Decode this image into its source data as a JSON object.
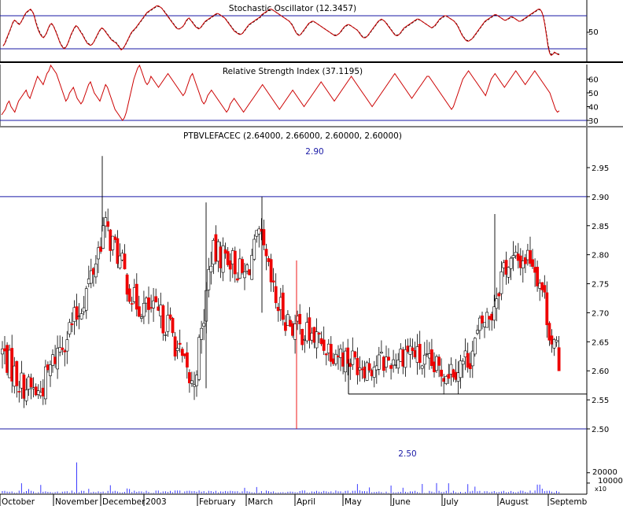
{
  "chart_data": {
    "type": "candlestick",
    "ticker_title": "PTBVLEFACEC (2.64000, 2.66000, 2.60000, 2.60000)",
    "last_bar": {
      "open": 2.64,
      "high": 2.66,
      "low": 2.6,
      "close": 2.6
    },
    "price_axis": {
      "ticks": [
        "2.95",
        "2.90",
        "2.85",
        "2.80",
        "2.75",
        "2.70",
        "2.65",
        "2.60",
        "2.55",
        "2.50"
      ],
      "range": [
        2.48,
        2.99
      ]
    },
    "stochastic": {
      "title": "Stochastic Oscillator (12.3457)",
      "tick": "50",
      "upper_level": 80,
      "lower_level": 20,
      "k": [
        25,
        30,
        38,
        45,
        52,
        60,
        68,
        72,
        70,
        66,
        64,
        68,
        74,
        80,
        85,
        88,
        90,
        92,
        88,
        82,
        70,
        60,
        52,
        46,
        42,
        40,
        44,
        50,
        58,
        64,
        66,
        62,
        55,
        48,
        40,
        32,
        26,
        22,
        20,
        24,
        30,
        38,
        46,
        52,
        58,
        62,
        60,
        55,
        50,
        46,
        40,
        35,
        30,
        28,
        26,
        28,
        32,
        38,
        44,
        50,
        55,
        58,
        56,
        52,
        48,
        44,
        40,
        36,
        34,
        32,
        30,
        26,
        22,
        18,
        20,
        24,
        30,
        36,
        42,
        48,
        52,
        55,
        58,
        62,
        66,
        70,
        74,
        78,
        82,
        86,
        88,
        90,
        92,
        94,
        96,
        98,
        98,
        96,
        94,
        90,
        86,
        82,
        78,
        74,
        70,
        66,
        62,
        58,
        56,
        56,
        58,
        60,
        64,
        70,
        74,
        76,
        72,
        68,
        64,
        60,
        58,
        56,
        58,
        62,
        66,
        70,
        72,
        74,
        76,
        78,
        80,
        82,
        84,
        84,
        82,
        80,
        78,
        76,
        72,
        68,
        64,
        60,
        56,
        52,
        50,
        48,
        46,
        46,
        48,
        52,
        56,
        60,
        64,
        66,
        68,
        70,
        72,
        74,
        76,
        78,
        82,
        84,
        86,
        88,
        90,
        92,
        92,
        90,
        88,
        86,
        84,
        82,
        80,
        78,
        76,
        74,
        72,
        70,
        66,
        62,
        56,
        50,
        46,
        44,
        46,
        50,
        54,
        58,
        62,
        66,
        68,
        70,
        70,
        68,
        66,
        64,
        62,
        60,
        58,
        56,
        54,
        52,
        50,
        48,
        46,
        44,
        44,
        46,
        48,
        52,
        56,
        60,
        62,
        64,
        64,
        62,
        60,
        58,
        56,
        54,
        50,
        46,
        42,
        40,
        40,
        42,
        46,
        50,
        54,
        58,
        62,
        66,
        70,
        72,
        74,
        72,
        70,
        66,
        62,
        58,
        54,
        50,
        46,
        44,
        44,
        46,
        50,
        54,
        58,
        60,
        62,
        64,
        66,
        68,
        70,
        72,
        74,
        74,
        72,
        70,
        68,
        66,
        64,
        62,
        60,
        58,
        60,
        62,
        66,
        70,
        74,
        76,
        78,
        80,
        80,
        78,
        76,
        74,
        72,
        70,
        66,
        62,
        56,
        50,
        44,
        40,
        36,
        34,
        34,
        36,
        38,
        42,
        46,
        50,
        54,
        58,
        62,
        66,
        70,
        72,
        74,
        76,
        78,
        80,
        82,
        82,
        80,
        78,
        76,
        74,
        72,
        72,
        74,
        76,
        78,
        78,
        76,
        74,
        72,
        70,
        70,
        72,
        74,
        76,
        78,
        80,
        82,
        84,
        86,
        88,
        90,
        92,
        92,
        88,
        80,
        65,
        45,
        25,
        12,
        8,
        10,
        14,
        12,
        10,
        9
      ],
      "d": [
        26,
        29,
        36,
        44,
        51,
        59,
        67,
        71,
        70,
        67,
        65,
        68,
        73,
        79,
        84,
        87,
        89,
        91,
        88,
        83,
        72,
        62,
        54,
        48,
        43,
        41,
        44,
        49,
        57,
        63,
        65,
        62,
        56,
        49,
        41,
        33,
        27,
        23,
        21,
        24,
        29,
        37,
        45,
        51,
        57,
        61,
        60,
        56,
        51,
        47,
        41,
        36,
        31,
        29,
        27,
        28,
        32,
        37,
        43,
        49,
        54,
        57,
        56,
        53,
        49,
        45,
        41,
        37,
        35,
        33,
        31,
        27,
        23,
        19,
        20,
        24,
        29,
        35,
        41,
        47,
        51,
        54,
        57,
        61,
        65,
        69,
        73,
        77,
        81,
        85,
        87,
        89,
        91,
        93,
        95,
        97,
        97,
        96,
        94,
        91,
        87,
        83,
        79,
        75,
        71,
        67,
        63,
        59,
        57,
        56,
        58,
        60,
        63,
        69,
        73,
        75,
        72,
        69,
        65,
        61,
        59,
        57,
        58,
        61,
        65,
        69,
        71,
        73,
        75,
        77,
        79,
        81,
        83,
        83,
        82,
        80,
        78,
        76,
        73,
        69,
        65,
        61,
        57,
        53,
        51,
        49,
        47,
        47,
        48,
        51,
        55,
        59,
        63,
        65,
        67,
        69,
        71,
        73,
        75,
        77,
        81,
        83,
        85,
        87,
        89,
        91,
        91,
        90,
        88,
        86,
        84,
        82,
        80,
        78,
        76,
        74,
        72,
        70,
        67,
        63,
        57,
        51,
        47,
        45,
        46,
        49,
        53,
        57,
        61,
        65,
        67,
        69,
        69,
        68,
        66,
        64,
        62,
        60,
        58,
        56,
        54,
        52,
        50,
        48,
        46,
        45,
        45,
        46,
        48,
        51,
        55,
        59,
        61,
        63,
        63,
        62,
        60,
        58,
        56,
        54,
        51,
        47,
        43,
        41,
        41,
        42,
        45,
        49,
        53,
        57,
        61,
        65,
        69,
        71,
        73,
        72,
        70,
        67,
        63,
        59,
        55,
        51,
        47,
        45,
        45,
        46,
        49,
        53,
        57,
        59,
        61,
        63,
        65,
        67,
        69,
        71,
        73,
        73,
        72,
        70,
        68,
        66,
        64,
        62,
        60,
        58,
        59,
        61,
        65,
        69,
        73,
        75,
        77,
        79,
        79,
        78,
        76,
        74,
        72,
        70,
        67,
        63,
        57,
        51,
        45,
        41,
        37,
        35,
        35,
        36,
        38,
        41,
        45,
        49,
        53,
        57,
        61,
        65,
        69,
        71,
        73,
        75,
        77,
        79,
        81,
        81,
        80,
        78,
        76,
        74,
        72,
        72,
        73,
        75,
        77,
        77,
        76,
        74,
        72,
        70,
        70,
        71,
        73,
        75,
        77,
        79,
        81,
        83,
        85,
        87,
        89,
        91,
        91,
        88,
        81,
        67,
        48,
        29,
        15,
        10,
        10,
        13,
        12,
        11,
        10
      ]
    },
    "rsi": {
      "title": "Relative Strength Index (37.1195)",
      "ticks": [
        "60",
        "50",
        "40",
        "30"
      ],
      "upper_level": 70,
      "lower_level": 30,
      "values": [
        34,
        36,
        38,
        42,
        44,
        40,
        38,
        36,
        40,
        44,
        46,
        48,
        50,
        52,
        48,
        46,
        50,
        54,
        58,
        62,
        60,
        58,
        56,
        60,
        64,
        66,
        70,
        68,
        66,
        64,
        60,
        56,
        52,
        48,
        44,
        46,
        50,
        52,
        54,
        50,
        46,
        44,
        42,
        44,
        48,
        52,
        56,
        58,
        54,
        50,
        48,
        46,
        44,
        48,
        52,
        56,
        54,
        50,
        46,
        42,
        38,
        36,
        34,
        32,
        30,
        32,
        36,
        42,
        48,
        54,
        60,
        64,
        68,
        70,
        66,
        62,
        58,
        56,
        58,
        62,
        60,
        58,
        56,
        54,
        56,
        58,
        60,
        62,
        64,
        62,
        60,
        58,
        56,
        54,
        52,
        50,
        48,
        50,
        54,
        58,
        62,
        64,
        60,
        56,
        52,
        48,
        44,
        42,
        44,
        48,
        50,
        52,
        50,
        48,
        46,
        44,
        42,
        40,
        38,
        36,
        38,
        42,
        44,
        46,
        44,
        42,
        40,
        38,
        36,
        38,
        40,
        42,
        44,
        46,
        48,
        50,
        52,
        54,
        56,
        54,
        52,
        50,
        48,
        46,
        44,
        42,
        40,
        38,
        40,
        42,
        44,
        46,
        48,
        50,
        52,
        50,
        48,
        46,
        44,
        42,
        40,
        42,
        44,
        46,
        48,
        50,
        52,
        54,
        56,
        58,
        56,
        54,
        52,
        50,
        48,
        46,
        44,
        46,
        48,
        50,
        52,
        54,
        56,
        58,
        60,
        62,
        60,
        58,
        56,
        54,
        52,
        50,
        48,
        46,
        44,
        42,
        40,
        42,
        44,
        46,
        48,
        50,
        52,
        54,
        56,
        58,
        60,
        62,
        64,
        62,
        60,
        58,
        56,
        54,
        52,
        50,
        48,
        46,
        48,
        50,
        52,
        54,
        56,
        58,
        60,
        62,
        62,
        60,
        58,
        56,
        54,
        52,
        50,
        48,
        46,
        44,
        42,
        40,
        38,
        40,
        44,
        48,
        52,
        56,
        60,
        62,
        64,
        66,
        64,
        62,
        60,
        58,
        56,
        54,
        52,
        50,
        48,
        52,
        56,
        60,
        62,
        64,
        62,
        60,
        58,
        56,
        54,
        56,
        58,
        60,
        62,
        64,
        66,
        64,
        62,
        60,
        58,
        56,
        58,
        60,
        62,
        64,
        66,
        64,
        62,
        60,
        58,
        56,
        54,
        52,
        50,
        46,
        42,
        38,
        36,
        37
      ]
    },
    "volume": {
      "ticks": [
        "20000",
        "10000"
      ],
      "multiplier_label": "x10",
      "scale_max": 32000
    },
    "annotations": {
      "upper_price": "2.90",
      "lower_price": "2.50"
    },
    "horizontal_levels": [
      2.9,
      2.5
    ],
    "support_line": {
      "value": 2.56,
      "from_month": "May"
    },
    "months": [
      "October",
      "November",
      "December",
      "2003",
      "February",
      "March",
      "April",
      "May",
      "June",
      "July",
      "August",
      "Septemb"
    ],
    "colors": {
      "up_candle": "#ffffff",
      "down_candle": "#ee0000",
      "level_line": "#1a1aa6",
      "oscillator": "#cc0000",
      "volume": "#3a3aff"
    },
    "bars": "generated"
  }
}
